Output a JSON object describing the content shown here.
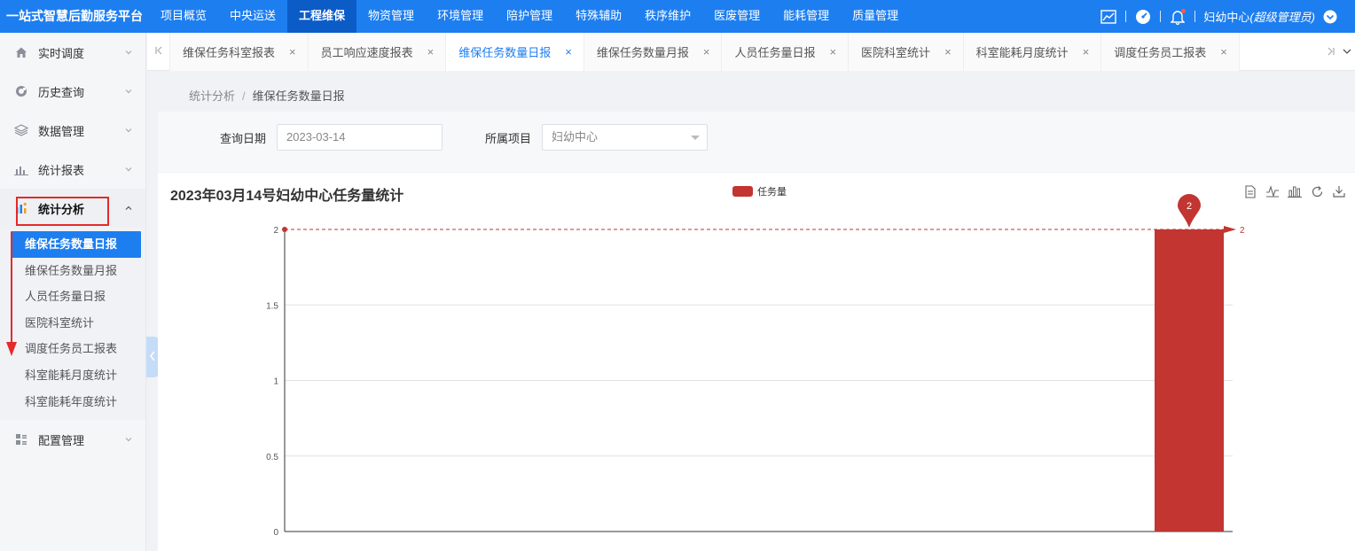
{
  "app": {
    "brand": "一站式智慧后勤服务平台",
    "nav": [
      "项目概览",
      "中央运送",
      "工程维保",
      "物资管理",
      "环境管理",
      "陪护管理",
      "特殊辅助",
      "秩序维护",
      "医废管理",
      "能耗管理",
      "质量管理"
    ],
    "nav_active_index": 2,
    "user": {
      "name": "妇幼中心",
      "role": "(超级管理员)"
    }
  },
  "sidebar": {
    "items": [
      {
        "label": "实时调度",
        "icon": "home-icon"
      },
      {
        "label": "历史查询",
        "icon": "history-icon"
      },
      {
        "label": "数据管理",
        "icon": "layers-icon"
      },
      {
        "label": "统计报表",
        "icon": "bar-report-icon"
      }
    ],
    "open_item": {
      "label": "统计分析",
      "icon": "analysis-icon"
    },
    "sub_items": [
      "维保任务数量日报",
      "维保任务数量月报",
      "人员任务量日报",
      "医院科室统计",
      "调度任务员工报表",
      "科室能耗月度统计",
      "科室能耗年度统计"
    ],
    "sub_active_index": 0,
    "last_item": {
      "label": "配置管理",
      "icon": "grid-icon"
    }
  },
  "tabs": {
    "items": [
      "维保任务科室报表",
      "员工响应速度报表",
      "维保任务数量日报",
      "维保任务数量月报",
      "人员任务量日报",
      "医院科室统计",
      "科室能耗月度统计",
      "调度任务员工报表"
    ],
    "active_index": 2,
    "close_glyph": "×"
  },
  "breadcrumb": {
    "parent": "统计分析",
    "sep": "/",
    "current": "维保任务数量日报"
  },
  "filter": {
    "date_label": "查询日期",
    "date_value": "2023-03-14",
    "project_label": "所属项目",
    "project_value": "妇幼中心"
  },
  "chart_data": {
    "type": "bar",
    "title": "2023年03月14号妇幼中心任务量统计",
    "legend": [
      "任务量"
    ],
    "categories": [
      ""
    ],
    "series": [
      {
        "name": "任务量",
        "values": [
          2
        ]
      }
    ],
    "ylim": [
      0,
      2
    ],
    "yticks": [
      "0",
      "0.5",
      "1",
      "1.5",
      "2"
    ],
    "mark_point": {
      "value": "2"
    },
    "mark_line": {
      "value": "2"
    },
    "color": "#c23531",
    "grid": true,
    "legend_position": "top-center",
    "toolbox": [
      "data-view-icon",
      "line-chart-icon",
      "bar-chart-icon",
      "restore-icon",
      "download-icon"
    ]
  }
}
